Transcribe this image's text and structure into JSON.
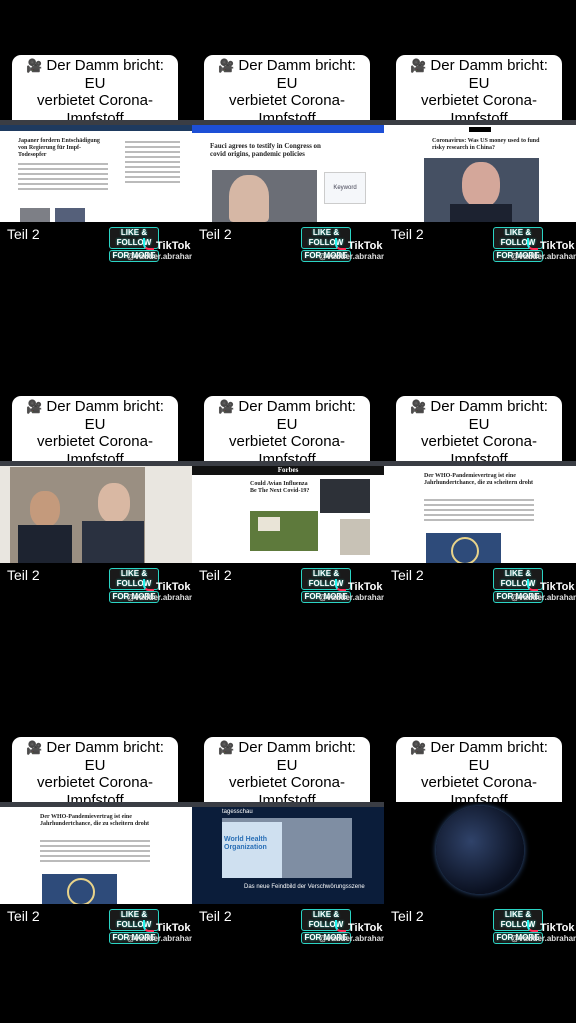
{
  "caption": {
    "line1": "Der Damm bricht: EU",
    "line2": "verbietet Corona-",
    "line3": "Impfstoff"
  },
  "overlay": {
    "part_label": "Teil 2",
    "like_line1": "LIKE & FOLLOW",
    "like_line2": "FOR MORE",
    "tiktok": "TikTok",
    "handle": "@vadder.abraham"
  },
  "icons": {
    "camera": "movie-camera-icon",
    "tiktok": "tiktok-logo-icon"
  },
  "cells": [
    {
      "headline": "Japaner fordern Entschädigung von Regierung für Impf-Todesopfer"
    },
    {
      "headline": "Fauci agrees to testify in Congress on covid origins, pandemic policies",
      "sidebar": "Keyword"
    },
    {
      "headline": "Coronavirus: Was US money used to fund risky research in China?"
    },
    {
      "headline": ""
    },
    {
      "headline": "Could Avian Influenza Be The Next Covid-19?",
      "header": "Forbes"
    },
    {
      "headline": "Der WHO-Pandemievertrag ist eine Jahrhundertchance, die zu scheitern droht"
    },
    {
      "headline": "Der WHO-Pandemievertrag ist eine Jahrhundertchance, die zu scheitern droht"
    },
    {
      "headline": "Das neue Feindbild der Verschwörungsszene",
      "brand": "tagesschau",
      "sign": "World Health Organization"
    },
    {
      "headline": ""
    }
  ]
}
